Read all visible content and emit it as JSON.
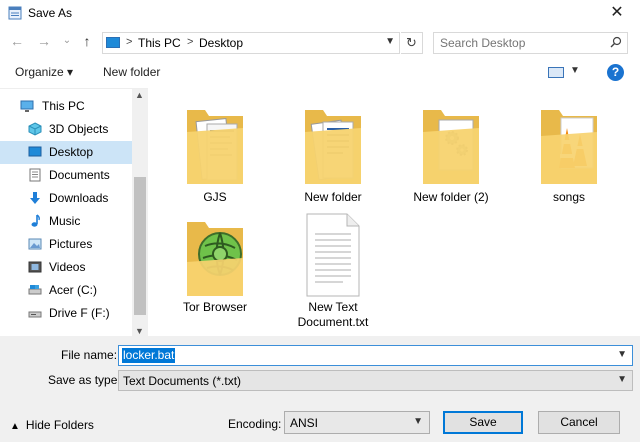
{
  "window": {
    "title": "Save As",
    "close_glyph": "✕"
  },
  "nav": {
    "back_glyph": "←",
    "forward_glyph": "→",
    "recent_glyph": "⌄",
    "up_glyph": "↑",
    "breadcrumbs": [
      "This PC",
      "Desktop"
    ],
    "crumb_sep": ">",
    "refresh_glyph": "↻",
    "search_placeholder": "Search Desktop"
  },
  "toolbar": {
    "organize_label": "Organize ▾",
    "new_folder_label": "New folder",
    "help_label": "?"
  },
  "sidebar": {
    "items": [
      {
        "label": "This PC",
        "icon": "computer-icon"
      },
      {
        "label": "3D Objects",
        "icon": "cube-icon"
      },
      {
        "label": "Desktop",
        "icon": "desktop-icon",
        "selected": true
      },
      {
        "label": "Documents",
        "icon": "documents-icon"
      },
      {
        "label": "Downloads",
        "icon": "download-icon"
      },
      {
        "label": "Music",
        "icon": "music-icon"
      },
      {
        "label": "Pictures",
        "icon": "pictures-icon"
      },
      {
        "label": "Videos",
        "icon": "videos-icon"
      },
      {
        "label": "Acer (C:)",
        "icon": "drive-icon"
      },
      {
        "label": "Drive F (F:)",
        "icon": "drive-icon"
      }
    ]
  },
  "files": [
    {
      "label": "GJS",
      "type": "folder",
      "icon": "folder-documents-icon"
    },
    {
      "label": "New folder",
      "type": "folder",
      "icon": "folder-documents-icon"
    },
    {
      "label": "New folder (2)",
      "type": "folder",
      "icon": "folder-gears-icon"
    },
    {
      "label": "songs",
      "type": "folder",
      "icon": "folder-vlc-icon"
    },
    {
      "label": "Tor Browser",
      "type": "folder",
      "icon": "folder-tor-icon"
    },
    {
      "label_line1": "New Text",
      "label_line2": "Document.txt",
      "type": "file",
      "icon": "text-file-icon"
    }
  ],
  "form": {
    "file_name_label": "File name:",
    "file_name_value": "locker.bat",
    "save_type_label": "Save as type:",
    "save_type_value": "Text Documents (*.txt)",
    "hide_folders_label": "Hide Folders",
    "encoding_label": "Encoding:",
    "encoding_value": "ANSI",
    "save_label": "Save",
    "cancel_label": "Cancel"
  },
  "colors": {
    "accent": "#0078d7",
    "selection": "#cce4f7",
    "folder": "#f5d26f"
  }
}
